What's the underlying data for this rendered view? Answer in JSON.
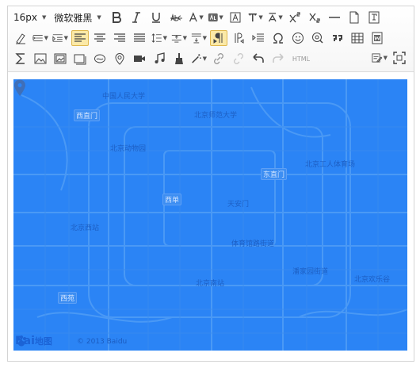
{
  "toolbar": {
    "font_size": "16px",
    "font_family": "微软雅黑",
    "html_label": "HTML"
  },
  "map": {
    "background": "#2b84f5",
    "logo_text": "Bai",
    "logo_text_2": "地图",
    "copyright": "© 2013 Baidu",
    "labels": [
      {
        "text": "中国人民大学"
      },
      {
        "text": "北京师范大学"
      },
      {
        "text": "北京动物园"
      },
      {
        "text": "北京西站"
      },
      {
        "text": "天安门"
      },
      {
        "text": "体育馆路街道"
      },
      {
        "text": "北京南站"
      },
      {
        "text": "北京工人体育场"
      },
      {
        "text": "潘家园街道"
      },
      {
        "text": "北京欢乐谷"
      }
    ],
    "tags": [
      {
        "text": "西直门"
      },
      {
        "text": "东直门"
      },
      {
        "text": "西单"
      },
      {
        "text": "西苑"
      }
    ]
  }
}
